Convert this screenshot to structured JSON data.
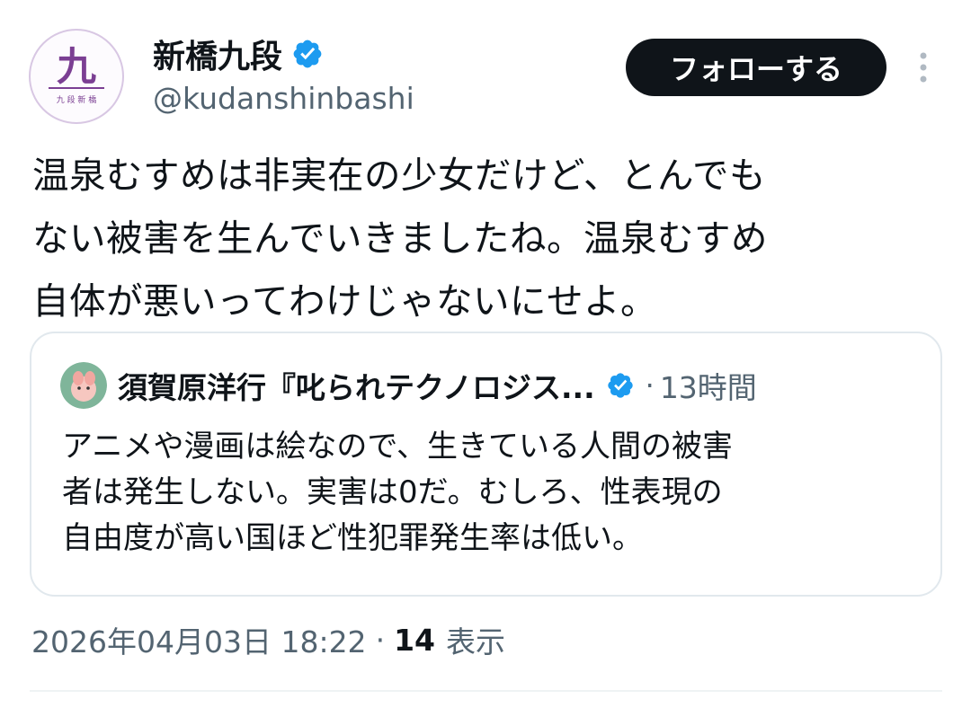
{
  "author": {
    "display_name": "新橋九段",
    "handle": "@kudanshinbashi",
    "avatar_glyph": "九",
    "avatar_subtitle": "九 段 新 橋",
    "verified_icon": "verified-badge-icon"
  },
  "header": {
    "follow_label": "フォローする",
    "more_icon": "more-vertical-icon"
  },
  "tweet": {
    "text_lines": [
      "温泉むすめは非実在の少女だけど、とんでも",
      "ない被害を生んでいきましたね。温泉むすめ",
      "自体が悪いってわけじゃないにせよ。"
    ]
  },
  "quote": {
    "author_name": "須賀原洋行『叱られテクノロジス...",
    "separator": "·",
    "time": "13時間",
    "text_lines": [
      "アニメや漫画は絵なので、生きている人間の被害",
      "者は発生しない。実害は0だ。むしろ、性表現の",
      "自由度が高い国ほど性犯罪発生率は低い。"
    ]
  },
  "meta": {
    "timestamp": "2026年04月03日 18:22",
    "separator": "·",
    "view_count": "14",
    "view_label": "表示"
  },
  "colors": {
    "text_primary": "#0f1419",
    "text_secondary": "#536471",
    "verified_blue": "#1d9bf0",
    "avatar_purple": "#7b3f93",
    "border": "#e1e8ed"
  }
}
